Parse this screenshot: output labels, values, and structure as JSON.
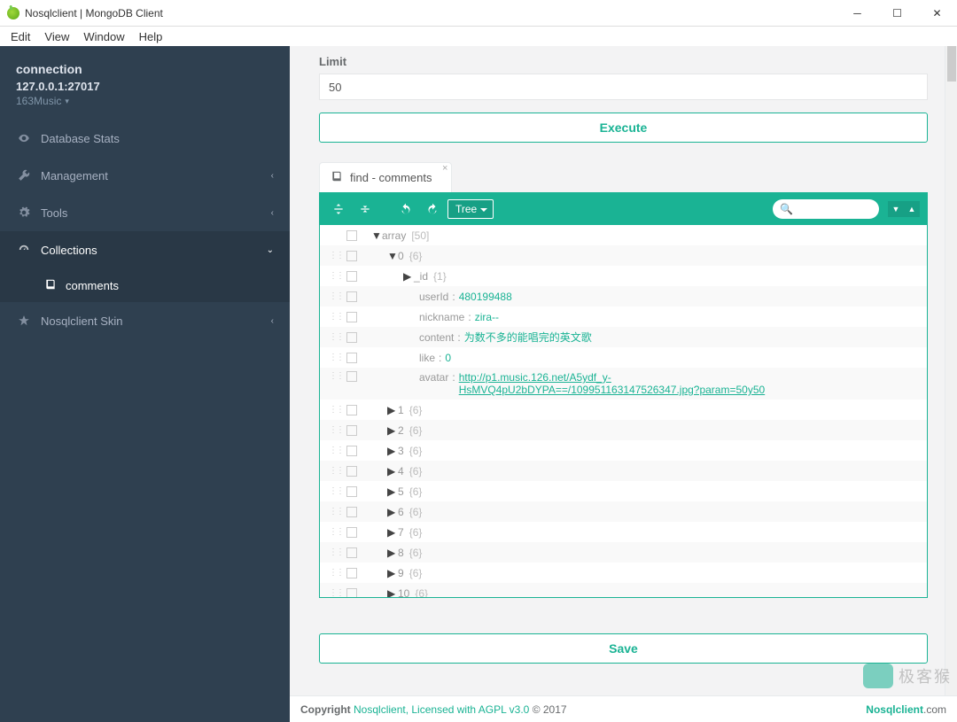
{
  "window": {
    "title": "Nosqlclient | MongoDB Client"
  },
  "menu": {
    "items": [
      "Edit",
      "View",
      "Window",
      "Help"
    ]
  },
  "connection": {
    "heading": "connection",
    "host": "127.0.0.1:27017",
    "db": "163Music"
  },
  "sidebar": [
    {
      "icon": "eye",
      "label": "Database Stats",
      "chev": null
    },
    {
      "icon": "wrench",
      "label": "Management",
      "chev": "‹"
    },
    {
      "icon": "cogs",
      "label": "Tools",
      "chev": "‹"
    },
    {
      "icon": "dashboard",
      "label": "Collections",
      "chev": "⌄",
      "active": true
    },
    {
      "icon": "star",
      "label": "Nosqlclient Skin",
      "chev": "‹"
    }
  ],
  "collections_sub": {
    "label": "comments"
  },
  "limit": {
    "label": "Limit",
    "value": "50"
  },
  "buttons": {
    "execute": "Execute",
    "save": "Save"
  },
  "tab": {
    "label": "find - comments"
  },
  "toolbar": {
    "view": "Tree"
  },
  "tree": {
    "root": {
      "label": "array",
      "meta": "[50]"
    },
    "item0": {
      "idx": "0",
      "meta": "{6}",
      "id": {
        "label": "_id",
        "meta": "{1}"
      },
      "fields": {
        "userId": {
          "key": "userId",
          "val": "480199488"
        },
        "nickname": {
          "key": "nickname",
          "val": "zira--"
        },
        "content": {
          "key": "content",
          "val": "为数不多的能唱完的英文歌"
        },
        "like": {
          "key": "like",
          "val": "0"
        },
        "avatar": {
          "key": "avatar",
          "val": "http://p1.music.126.net/A5ydf_y-HsMVQ4pU2bDYPA==/109951163147526347.jpg?param=50y50"
        }
      }
    },
    "rest": [
      {
        "idx": "1",
        "meta": "{6}"
      },
      {
        "idx": "2",
        "meta": "{6}"
      },
      {
        "idx": "3",
        "meta": "{6}"
      },
      {
        "idx": "4",
        "meta": "{6}"
      },
      {
        "idx": "5",
        "meta": "{6}"
      },
      {
        "idx": "6",
        "meta": "{6}"
      },
      {
        "idx": "7",
        "meta": "{6}"
      },
      {
        "idx": "8",
        "meta": "{6}"
      },
      {
        "idx": "9",
        "meta": "{6}"
      },
      {
        "idx": "10",
        "meta": "{6}"
      }
    ]
  },
  "footer": {
    "copyright": "Copyright",
    "license": "Nosqlclient, Licensed with AGPL v3.0",
    "year": "© 2017",
    "brand": "Nosqlclient",
    "brand_suffix": ".com"
  },
  "watermark": "极客猴"
}
